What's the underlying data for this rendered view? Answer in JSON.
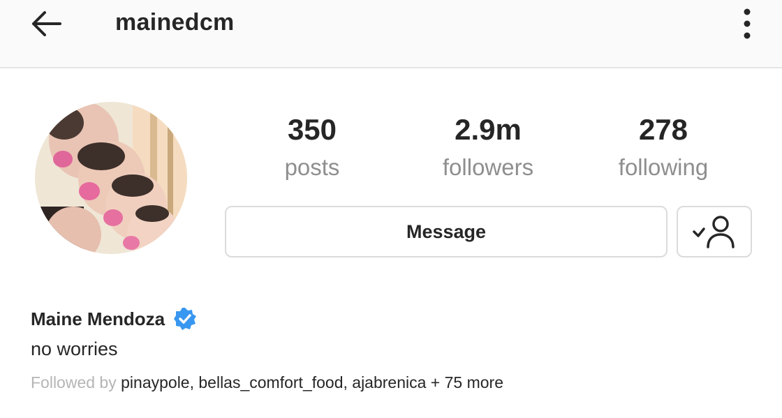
{
  "header": {
    "username": "mainedcm",
    "back_icon": "arrow-left-icon",
    "more_icon": "more-vertical-icon"
  },
  "profile": {
    "avatar_icon": "profile-photo",
    "stats": [
      {
        "value": "350",
        "label": "posts"
      },
      {
        "value": "2.9m",
        "label": "followers"
      },
      {
        "value": "278",
        "label": "following"
      }
    ],
    "message_label": "Message",
    "following_icon": "person-check-icon",
    "full_name": "Maine Mendoza",
    "verified_icon": "verified-badge-icon",
    "bio": "no worries",
    "followed_by_prefix": "Followed by",
    "followed_by_names": "pinaypole, bellas_comfort_food, ajabrenica + 75 more"
  },
  "colors": {
    "verified": "#3897f0",
    "text": "#262626",
    "muted": "#8e8e8e",
    "border": "#dbdbdb"
  }
}
